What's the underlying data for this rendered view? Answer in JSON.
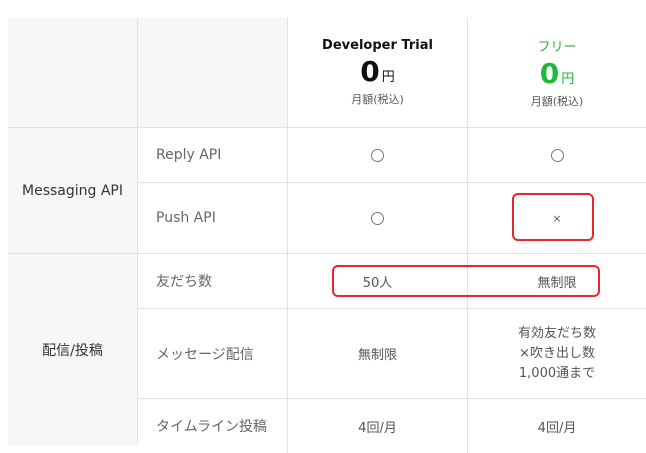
{
  "plans": [
    {
      "name": "Developer Trial",
      "price": "0",
      "unit": "円",
      "period": "月額(税込)",
      "color": "#111111"
    },
    {
      "name": "フリー",
      "price": "0",
      "unit": "円",
      "period": "月額(税込)",
      "color": "#22b83a"
    }
  ],
  "sections": [
    {
      "name": "Messaging API",
      "rows": [
        {
          "label": "Reply API",
          "trial": "circle",
          "free": "circle"
        },
        {
          "label": "Push API",
          "trial": "circle",
          "free": "×"
        }
      ]
    },
    {
      "name": "配信/投稿",
      "rows": [
        {
          "label": "友だち数",
          "trial": "50人",
          "free": "無制限"
        },
        {
          "label": "メッセージ配信",
          "trial": "無制限",
          "free": [
            "有効友だち数",
            "×吹き出し数",
            "1,000通まで"
          ]
        },
        {
          "label": "タイムライン投稿",
          "trial": "4回/月",
          "free": "4回/月"
        }
      ]
    }
  ],
  "highlight_color": "#e8262f"
}
